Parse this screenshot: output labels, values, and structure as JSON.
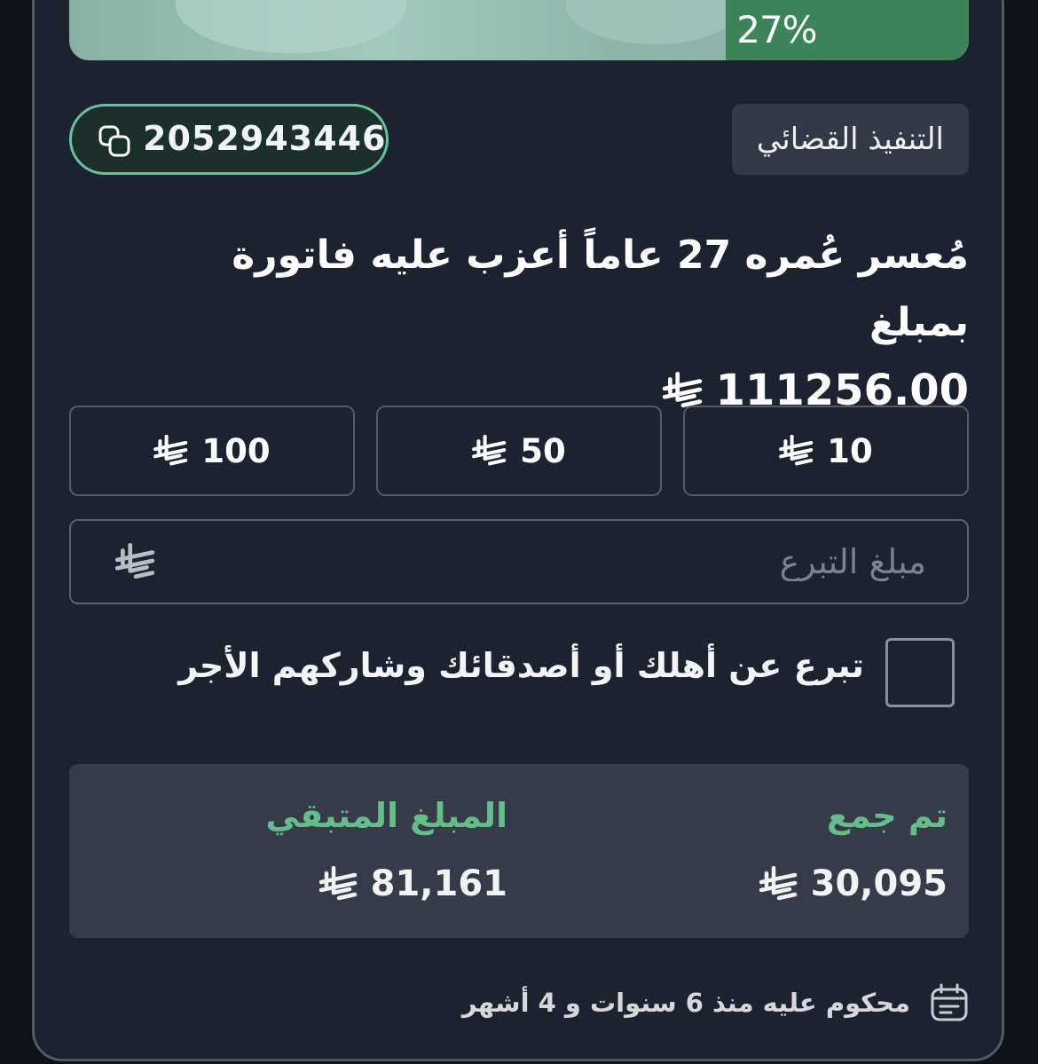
{
  "progress": {
    "percent_label": "27%",
    "fraction": 0.27
  },
  "case": {
    "id": "2052943446",
    "category": "التنفيذ القضائي",
    "title_line1": "مُعسر عُمره 27 عاماً أعزب عليه فاتورة بمبلغ",
    "title_amount": "111256.00"
  },
  "quick_amounts": [
    "10",
    "50",
    "100"
  ],
  "donation_input": {
    "placeholder": "مبلغ التبرع",
    "value": ""
  },
  "gift_option": {
    "label": "تبرع عن أهلك أو أصدقائك وشاركهم الأجر",
    "checked": false
  },
  "stats": {
    "collected_label": "تم جمع",
    "collected_value": "30,095",
    "remaining_label": "المبلغ المتبقي",
    "remaining_value": "81,161"
  },
  "footer": {
    "sentence_text": "محكوم عليه منذ 6 سنوات و 4 أشهر"
  },
  "icons": {
    "copy": "copy-icon",
    "currency": "saudi-riyal-icon",
    "calendar": "calendar-icon"
  },
  "colors": {
    "background": "#1c2230",
    "accent_green": "#66bd8b",
    "progress_green": "#3f8459",
    "pill_border": "#69c19d"
  }
}
